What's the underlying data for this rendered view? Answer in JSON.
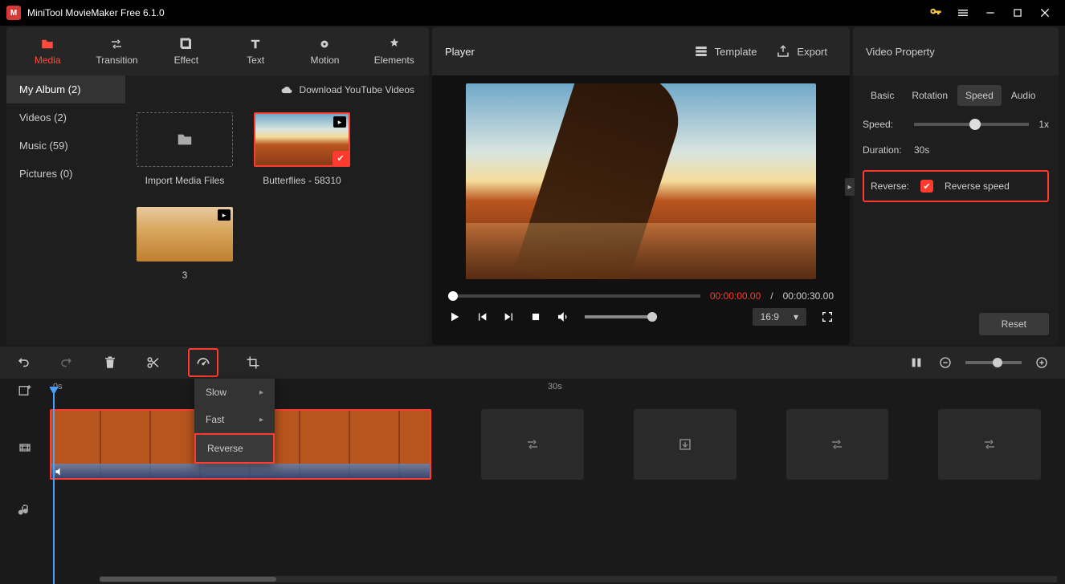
{
  "titlebar": {
    "title": "MiniTool MovieMaker Free 6.1.0"
  },
  "toptabs": {
    "media": "Media",
    "transition": "Transition",
    "effect": "Effect",
    "text": "Text",
    "motion": "Motion",
    "elements": "Elements"
  },
  "media_sidebar": {
    "my_album": "My Album (2)",
    "videos": "Videos (2)",
    "music": "Music (59)",
    "pictures": "Pictures (0)"
  },
  "media": {
    "download_yt": "Download YouTube Videos",
    "import": "Import Media Files",
    "item1": "Butterflies - 58310",
    "item2": "3"
  },
  "player": {
    "title": "Player",
    "template": "Template",
    "export": "Export",
    "time_cur": "00:00:00.00",
    "time_sep": "/",
    "time_tot": "00:00:30.00",
    "ratio": "16:9"
  },
  "property": {
    "title": "Video Property",
    "tabs": {
      "basic": "Basic",
      "rotation": "Rotation",
      "speed": "Speed",
      "audio": "Audio"
    },
    "speed_label": "Speed:",
    "speed_value": "1x",
    "duration_label": "Duration:",
    "duration_value": "30s",
    "reverse_label": "Reverse:",
    "reverse_speed": "Reverse speed",
    "reset": "Reset"
  },
  "timeline": {
    "ruler": {
      "t0": "0s",
      "t30": "30s"
    }
  },
  "speed_menu": {
    "slow": "Slow",
    "fast": "Fast",
    "reverse": "Reverse"
  }
}
